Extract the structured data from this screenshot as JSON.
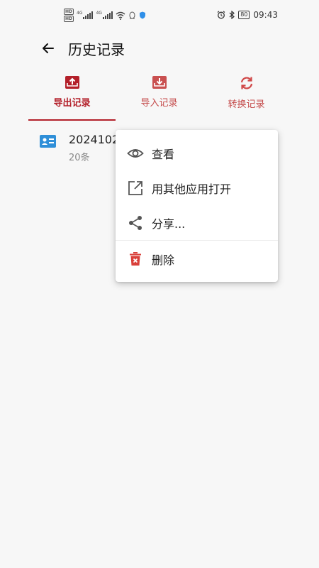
{
  "status_bar": {
    "time": "09:43",
    "battery": "80",
    "signal_labels": [
      "4G",
      "4G"
    ],
    "hd_labels": [
      "HD",
      "HD"
    ]
  },
  "header": {
    "title": "历史记录"
  },
  "tabs": [
    {
      "label": "导出记录",
      "active": true
    },
    {
      "label": "导入记录",
      "active": false
    },
    {
      "label": "转换记录",
      "active": false
    }
  ],
  "records": [
    {
      "name": "2024102",
      "count": "20条"
    }
  ],
  "popup_menu": {
    "items": [
      {
        "label": "查看",
        "icon": "eye-icon"
      },
      {
        "label": "用其他应用打开",
        "icon": "open-external-icon"
      },
      {
        "label": "分享...",
        "icon": "share-icon"
      },
      {
        "label": "删除",
        "icon": "trash-icon"
      }
    ]
  },
  "colors": {
    "accent": "#b3202a",
    "tab_inactive": "#c44a4a",
    "record_icon": "#2f8fd8",
    "delete_icon": "#d9403a",
    "background": "#f7f7f7"
  }
}
